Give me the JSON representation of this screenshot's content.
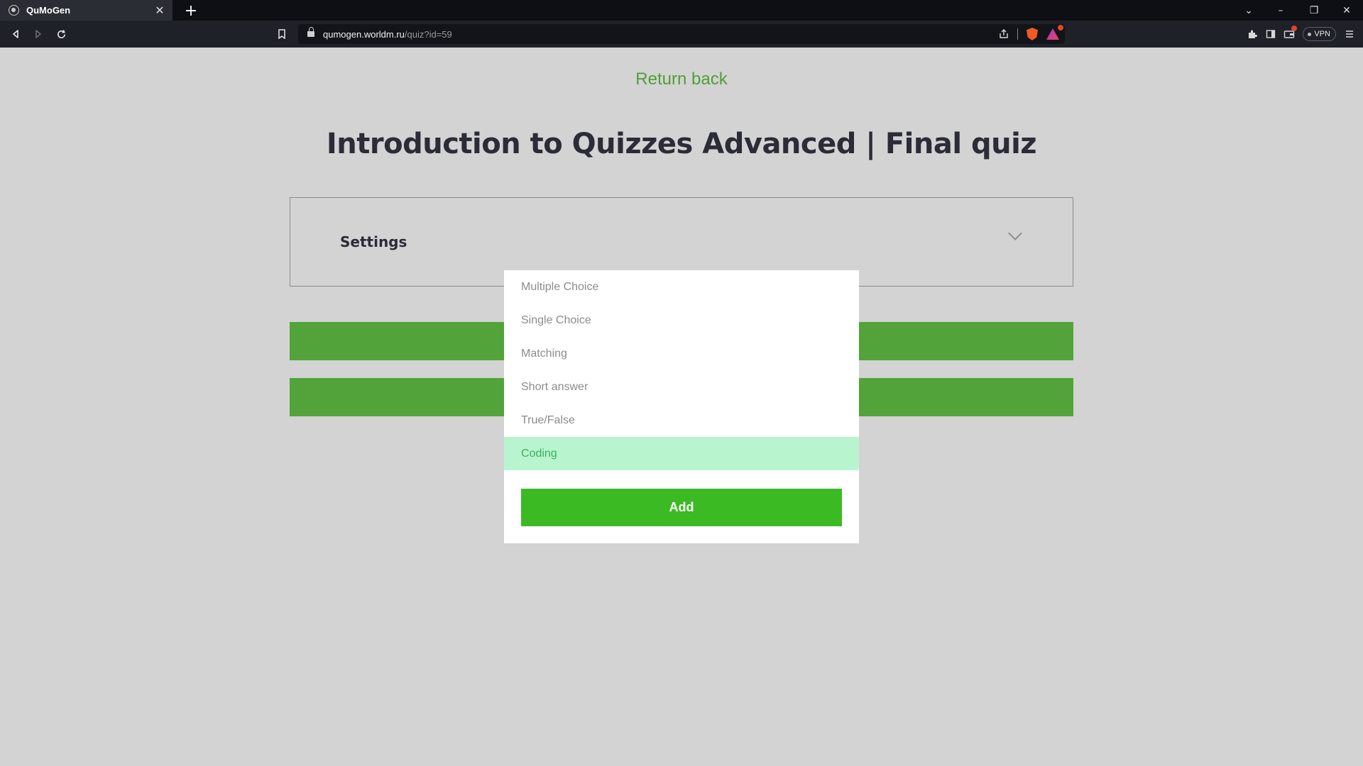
{
  "browser": {
    "tab_title": "QuMoGen",
    "tab_close": "✕",
    "new_tab": "+",
    "url_host": "qumogen.worldm.ru",
    "url_path": "/quiz?id=59",
    "vpn_label": "VPN",
    "window_controls": {
      "dropdown": "⌄",
      "minimize": "–",
      "restore": "❐",
      "close": "✕"
    }
  },
  "page": {
    "return_link": "Return back",
    "title": "Introduction to Quizzes Advanced | Final quiz",
    "settings_label": "Settings"
  },
  "dropdown": {
    "options": [
      {
        "label": "Multiple Choice",
        "selected": false
      },
      {
        "label": "Single Choice",
        "selected": false
      },
      {
        "label": "Matching",
        "selected": false
      },
      {
        "label": "Short answer",
        "selected": false
      },
      {
        "label": "True/False",
        "selected": false
      },
      {
        "label": "Coding",
        "selected": true
      }
    ],
    "add_label": "Add"
  },
  "colors": {
    "accent_green": "#51a33a",
    "add_button": "#3cba24",
    "selected_bg": "#b8f5cf",
    "page_bg": "#d3d3d3"
  }
}
